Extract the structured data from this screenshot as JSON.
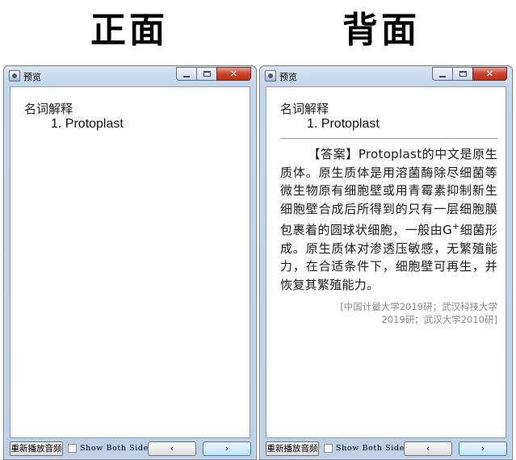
{
  "headings": {
    "front": "正面",
    "back": "背面"
  },
  "window": {
    "title": "预览",
    "controls": {
      "minimize": "",
      "maximize": "",
      "close": "✕"
    }
  },
  "front": {
    "section_label": "名词解释",
    "term": "1. Protoplast"
  },
  "back": {
    "section_label": "名词解释",
    "term": "1. Protoplast",
    "answer_part1": "【答案】Protoplast的中文是原生质体。原生质体是用溶菌酶除尽细菌等微生物原有细胞壁或用青霉素抑制新生细胞壁合成后所得到的只有一层细胞膜包裹着的圆球状细胞，一般由G",
    "answer_sup": "+",
    "answer_part2": "细菌形成。原生质体对渗透压敏感，无繁殖能力，在合适条件下，细胞壁可再生，并恢复其繁殖能力。",
    "source": "[中国计量大学2019研；武汉科技大学2019研；武汉大学2010研]"
  },
  "bottom_bar": {
    "replay_label": "重新播放音频",
    "both_sides_label": "Show Both Sides",
    "both_sides_checked": false,
    "prev_label": "‹",
    "next_label": "›"
  },
  "colors": {
    "window_frame": "#bdd0e6",
    "close_button": "#c9442a",
    "next_button": "#bee6fd",
    "source_text": "#8a8a8a"
  },
  "icons": {
    "app": "app-icon",
    "minimize": "minimize-icon",
    "maximize": "maximize-icon",
    "close": "close-icon"
  }
}
